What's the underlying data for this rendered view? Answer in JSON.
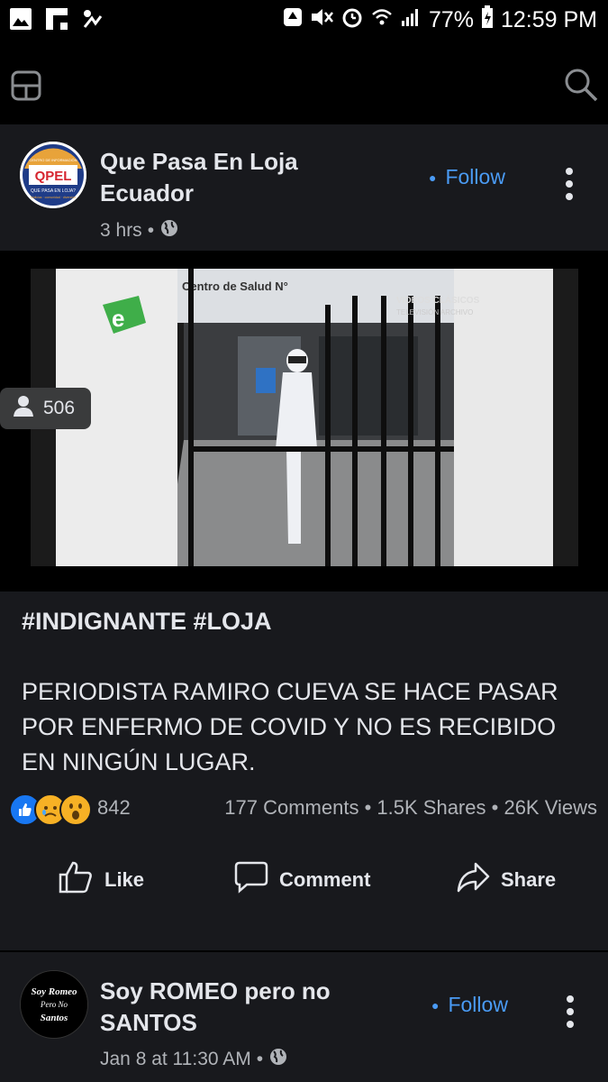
{
  "status_bar": {
    "battery": "77%",
    "time": "12:59 PM"
  },
  "posts": [
    {
      "author": "Que Pasa En Loja Ecuador",
      "author_line1": "Que Pasa En Loja",
      "author_line2": "Ecuador",
      "avatar_text": {
        "top": "CENTRO DE INFORMACIÓN",
        "logo": "QPEL",
        "mid": "QUE PASA EN LOJA?",
        "bottom": "Noticias · comunidad · diversión"
      },
      "time": "3 hrs",
      "follow_label": "Follow",
      "viewers": "506",
      "video_caption": {
        "sign": "Centro de Salud N°",
        "overlay_line1": "VIDEOS CLÁSICOS",
        "overlay_line2": "TELEVISIÓN ARCHIVO"
      },
      "hashtags": "#INDIGNANTE #LOJA",
      "body": "PERIODISTA RAMIRO CUEVA SE HACE PASAR POR ENFERMO DE COVID Y NO ES RECIBIDO EN NINGÚN LUGAR.",
      "reactions_count": "842",
      "comments": "177 Comments",
      "shares": "1.5K Shares",
      "views": "26K Views",
      "actions": {
        "like": "Like",
        "comment": "Comment",
        "share": "Share"
      }
    },
    {
      "author_line1": "Soy ROMEO pero no",
      "author_line2": "SANTOS",
      "avatar_text": {
        "line1": "Soy Romeo",
        "line2": "Pero No",
        "line3": "Santos"
      },
      "time": "Jan 8 at 11:30 AM",
      "follow_label": "Follow"
    }
  ],
  "colors": {
    "background": "#000000",
    "card": "#18191d",
    "accent": "#4a9bf5",
    "like_blue": "#1877f2",
    "text_primary": "#e4e6eb",
    "text_secondary": "#b0b3b8"
  },
  "icons": [
    "gallery-icon",
    "flipboard-icon",
    "signal-icon",
    "recycle-icon",
    "mute-icon",
    "alarm-icon",
    "wifi-icon",
    "cell-signal-icon",
    "battery-icon",
    "news-feed-icon",
    "search-icon",
    "globe-icon",
    "person-icon",
    "like-icon",
    "comment-icon",
    "share-icon"
  ]
}
